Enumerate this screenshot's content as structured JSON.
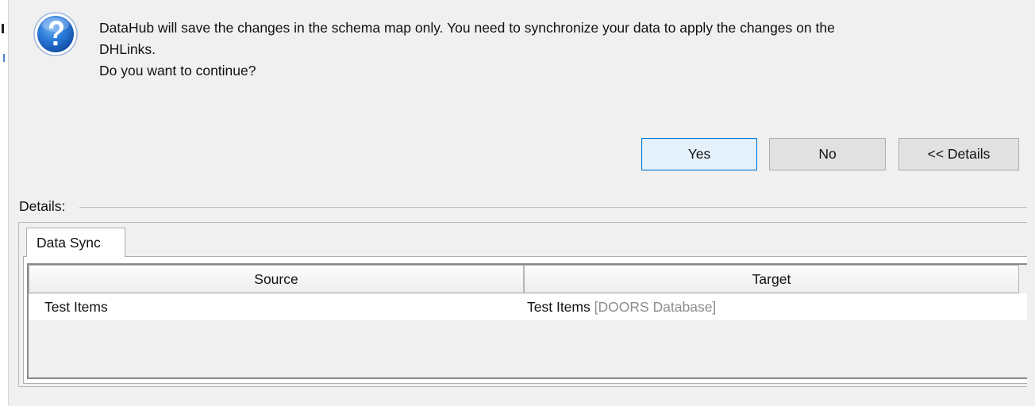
{
  "dialog": {
    "message_lines": [
      "DataHub will save the changes in the schema map only. You need to synchronize your data to apply the changes on the",
      "DHLinks.",
      "Do you want to continue?"
    ],
    "icon": "question-icon",
    "buttons": {
      "yes": "Yes",
      "no": "No",
      "details": "<< Details"
    }
  },
  "details": {
    "label": "Details:",
    "tabs": [
      {
        "label": "Data Sync",
        "selected": true
      }
    ],
    "table": {
      "columns": [
        "Source",
        "Target"
      ],
      "rows": [
        {
          "source": "Test Items",
          "target": "Test Items",
          "target_suffix": "[DOORS Database]"
        }
      ]
    }
  },
  "colors": {
    "dialog_background": "#f0f0f0",
    "default_button_border": "#0078d7",
    "icon_blue": "#1f6ed0",
    "muted_text": "#8c8c8c"
  }
}
